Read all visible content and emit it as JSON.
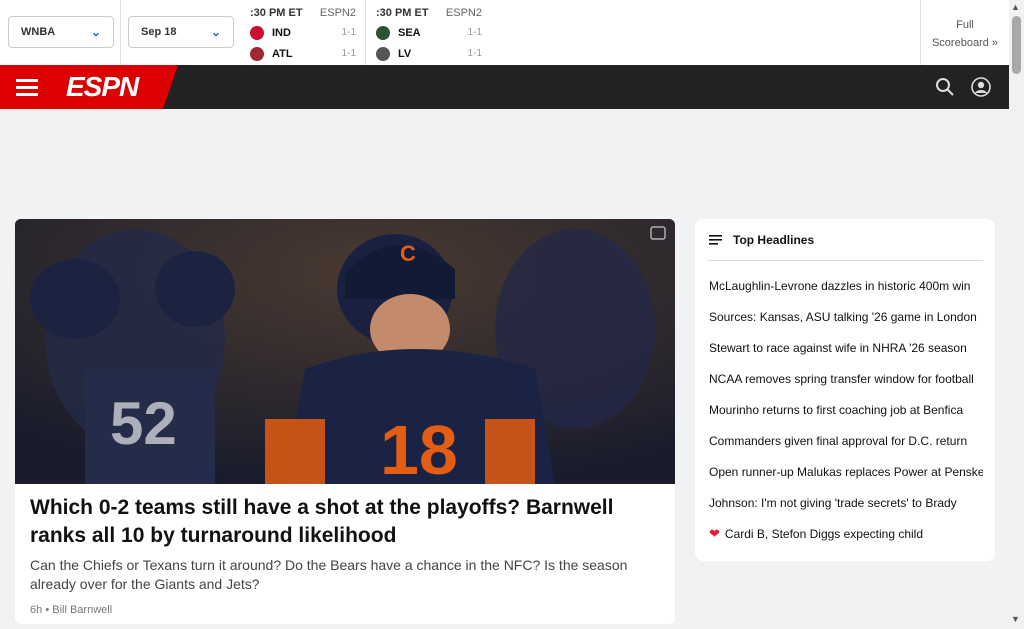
{
  "scoreboard": {
    "league_dropdown": "WNBA",
    "date_dropdown": "Sep 18",
    "games": [
      {
        "time": ":30 PM ET",
        "network": "ESPN2",
        "teams": [
          {
            "abbr": "IND",
            "record": "1-1",
            "color": "#c8102e"
          },
          {
            "abbr": "ATL",
            "record": "1-1",
            "color": "#a0282f"
          }
        ]
      },
      {
        "time": ":30 PM ET",
        "network": "ESPN2",
        "teams": [
          {
            "abbr": "SEA",
            "record": "1-1",
            "color": "#2c5234"
          },
          {
            "abbr": "LV",
            "record": "1-1",
            "color": "#555555"
          }
        ]
      }
    ],
    "full_scoreboard_line1": "Full",
    "full_scoreboard_line2": "Scoreboard »"
  },
  "nav": {
    "logo": "ESPN",
    "icons": [
      "menu-icon",
      "search-icon",
      "account-icon"
    ],
    "brand_color": "#d00000"
  },
  "hero": {
    "title": "Which 0-2 teams still have a shot at the playoffs? Barnwell ranks all 10 by turnaround likelihood",
    "subtitle": "Can the Chiefs or Texans turn it around? Do the Bears have a chance in the NFC? Is the season already over for the Giants and Jets?",
    "age": "6h",
    "author": "Bill Barnwell",
    "jersey_number": "18"
  },
  "headlines": {
    "title": "Top Headlines",
    "items": [
      "McLaughlin-Levrone dazzles in historic 400m win",
      "Sources: Kansas, ASU talking '26 game in London",
      "Stewart to race against wife in NHRA '26 season",
      "NCAA removes spring transfer window for football",
      "Mourinho returns to first coaching job at Benfica",
      "Commanders given final approval for D.C. return",
      "Open runner-up Malukas replaces Power at Penske",
      "Johnson: I'm not giving 'trade secrets' to Brady",
      "Cardi B, Stefon Diggs expecting child"
    ]
  }
}
